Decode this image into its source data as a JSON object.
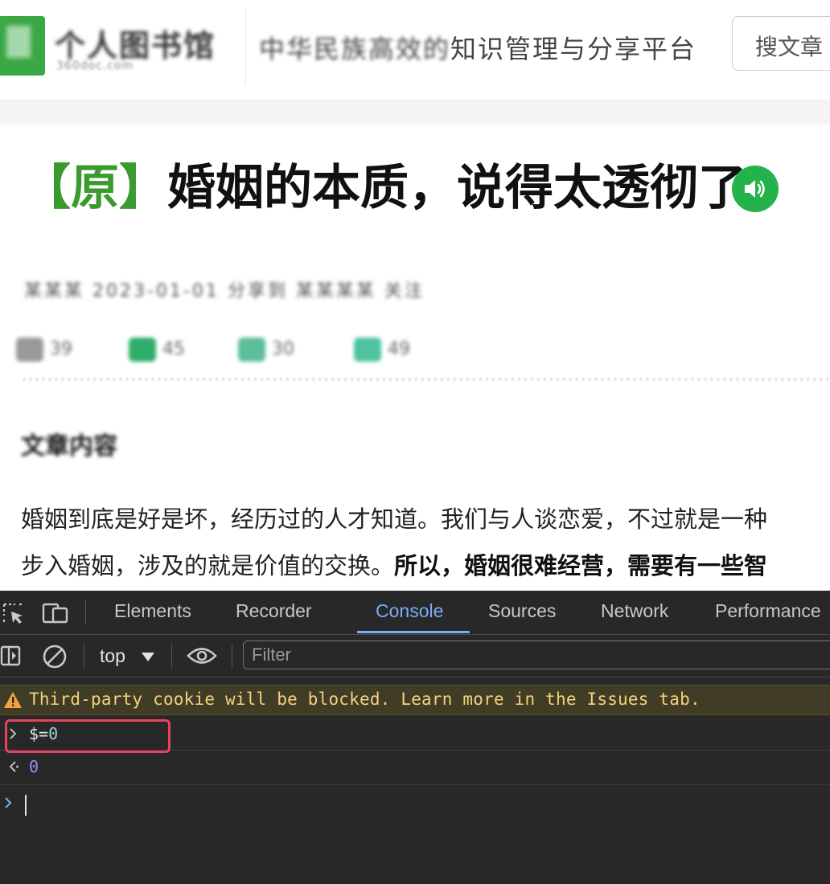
{
  "header": {
    "logo_text": "个人图书馆",
    "logo_sub": "360doc.com",
    "slogan_blurred": "中华民族高效的",
    "slogan_clear": "知识管理与分享平台",
    "search_label": "搜文章"
  },
  "article": {
    "orig_tag": "【原】",
    "title": "婚姻的本质，说得太透彻了",
    "meta": "某某某 2023-01-01 分享到 某某某某 关注",
    "stats": [
      "39",
      "45",
      "30",
      "49"
    ],
    "section_title": "文章内容",
    "para1": "婚姻到底是好是坏，经历过的人才知道。我们与人谈恋爱，不过就是一种",
    "para2_normal": "步入婚姻，涉及的就是价值的交换。",
    "para2_bold": "所以，婚姻很难经营，需要有一些智"
  },
  "devtools": {
    "tabs": [
      "Elements",
      "Recorder",
      "Console",
      "Sources",
      "Network",
      "Performance"
    ],
    "active_tab": "Console",
    "context": "top",
    "filter_placeholder": "Filter",
    "warning": "Third-party cookie will be blocked. Learn more in the Issues tab.",
    "input_expr": "$=",
    "input_value": "0",
    "output_value": "0",
    "colors": {
      "background": "#282828",
      "active_tab": "#7cacf8",
      "warning_bg": "#413c26",
      "warning_text": "#f2d37a",
      "highlight": "#e8425e",
      "output_number": "#9a89ff"
    }
  }
}
